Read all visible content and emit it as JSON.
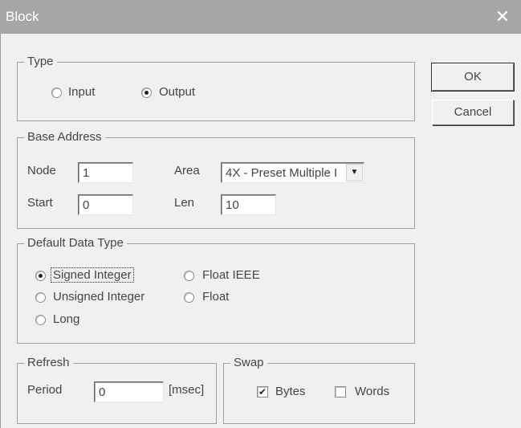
{
  "window": {
    "title": "Block",
    "close_glyph": "✕"
  },
  "type_group": {
    "legend": "Type",
    "options": [
      {
        "label": "Input",
        "checked": false
      },
      {
        "label": "Output",
        "checked": true
      }
    ]
  },
  "buttons": {
    "ok_label": "OK",
    "cancel_label": "Cancel"
  },
  "base_address": {
    "legend": "Base Address",
    "node_label": "Node",
    "node_value": "1",
    "area_label": "Area",
    "area_value": "4X - Preset Multiple I",
    "start_label": "Start",
    "start_value": "0",
    "len_label": "Len",
    "len_value": "10"
  },
  "data_type": {
    "legend": "Default Data Type",
    "signed": "Signed Integer",
    "unsigned": "Unsigned Integer",
    "long": "Long",
    "float_ieee": "Float IEEE",
    "float": "Float",
    "selected": "Signed Integer"
  },
  "refresh": {
    "legend": "Refresh",
    "period_label": "Period",
    "period_value": "0",
    "unit": "[msec]"
  },
  "swap": {
    "legend": "Swap",
    "bytes_label": "Bytes",
    "bytes_checked": true,
    "words_label": "Words",
    "words_checked": false
  },
  "icons": {
    "dropdown": "chevron-down-icon",
    "check": "checkmark-icon"
  }
}
